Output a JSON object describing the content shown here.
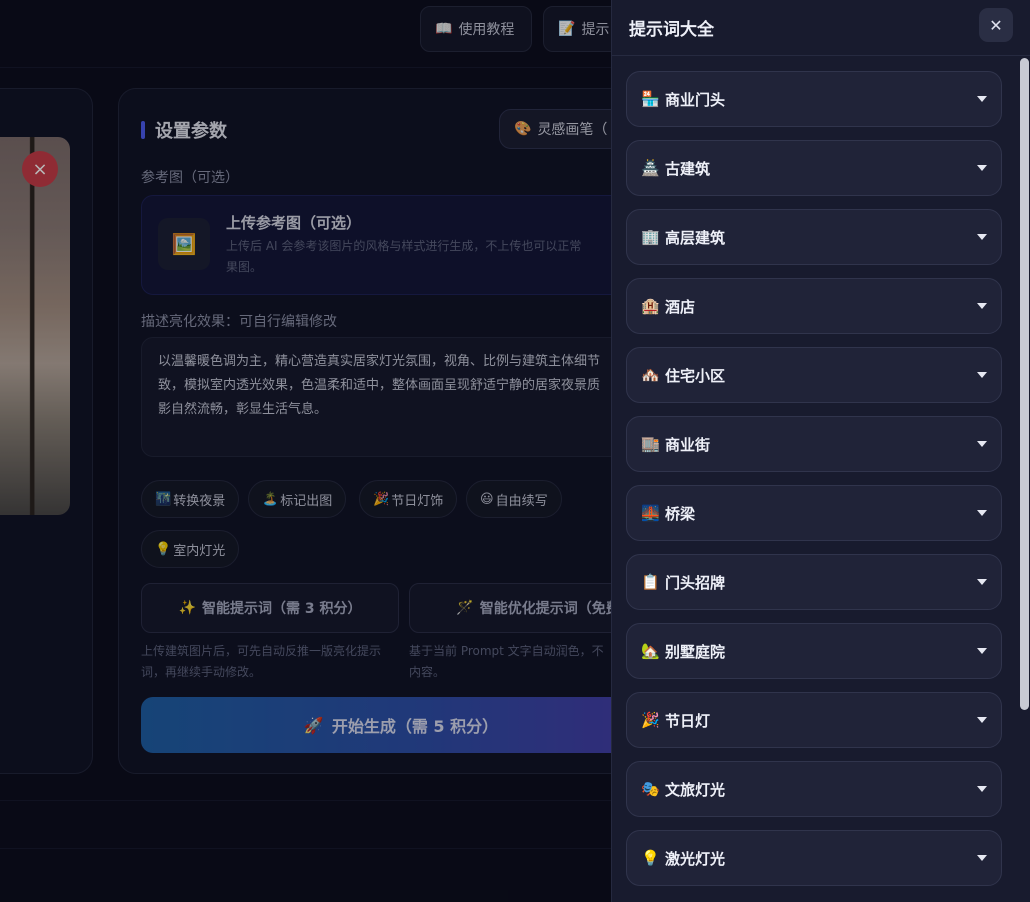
{
  "topbar": {
    "tutorial": {
      "icon": "📖",
      "label": "使用教程"
    },
    "prompt": {
      "icon": "📝",
      "label": "提示"
    }
  },
  "settings": {
    "title": "设置参数",
    "inspire": {
      "icon": "🎨",
      "label": "灵感画笔（"
    },
    "reference_label": "参考图（可选）",
    "upload": {
      "icon": "🖼️",
      "title": "上传参考图（可选）",
      "desc": "上传后 AI 会参考该图片的风格与样式进行生成，不上传也可以正常",
      "desc2": "果图。"
    },
    "describe_label": "描述亮化效果：可自行编辑修改",
    "description": "以温馨暖色调为主，精心营造真实居家灯光氛围，视角、比例与建筑主体细节",
    "description2": "致，模拟室内透光效果，色温柔和适中，整体画面呈现舒适宁静的居家夜景质",
    "description3": "影自然流畅，彰显生活气息。",
    "chips": [
      {
        "icon": "🌃",
        "label": "转换夜景"
      },
      {
        "icon": "🏝️",
        "label": "标记出图"
      },
      {
        "icon": "🎉",
        "label": "节日灯饰"
      },
      {
        "icon": "😃",
        "label": "自由续写"
      },
      {
        "icon": "💡",
        "label": "室内灯光"
      }
    ],
    "smart_prompt": {
      "icon": "✨",
      "label": "智能提示词（需 3 积分）"
    },
    "optimize_prompt": {
      "icon": "🪄",
      "label": "智能优化提示词（免费"
    },
    "hint_left": "上传建筑图片后，可先自动反推一版亮化提示词，再继续手动修改。",
    "hint_right": "基于当前 Prompt 文字自动润色，不",
    "hint_right2": "内容。",
    "generate": {
      "icon": "🚀",
      "label": "开始生成（需 5 积分）"
    }
  },
  "preview": {
    "close_icon": "×"
  },
  "drawer": {
    "title": "提示词大全",
    "close": "✕",
    "items": [
      {
        "emoji": "🏪",
        "label": "商业门头"
      },
      {
        "emoji": "🏯",
        "label": "古建筑"
      },
      {
        "emoji": "🏢",
        "label": "高层建筑"
      },
      {
        "emoji": "🏨",
        "label": "酒店"
      },
      {
        "emoji": "🏘️",
        "label": "住宅小区"
      },
      {
        "emoji": "🏬",
        "label": "商业街"
      },
      {
        "emoji": "🌉",
        "label": "桥梁"
      },
      {
        "emoji": "📋",
        "label": "门头招牌"
      },
      {
        "emoji": "🏡",
        "label": "别墅庭院"
      },
      {
        "emoji": "🎉",
        "label": "节日灯"
      },
      {
        "emoji": "🎭",
        "label": "文旅灯光"
      },
      {
        "emoji": "💡",
        "label": "激光灯光"
      }
    ]
  }
}
